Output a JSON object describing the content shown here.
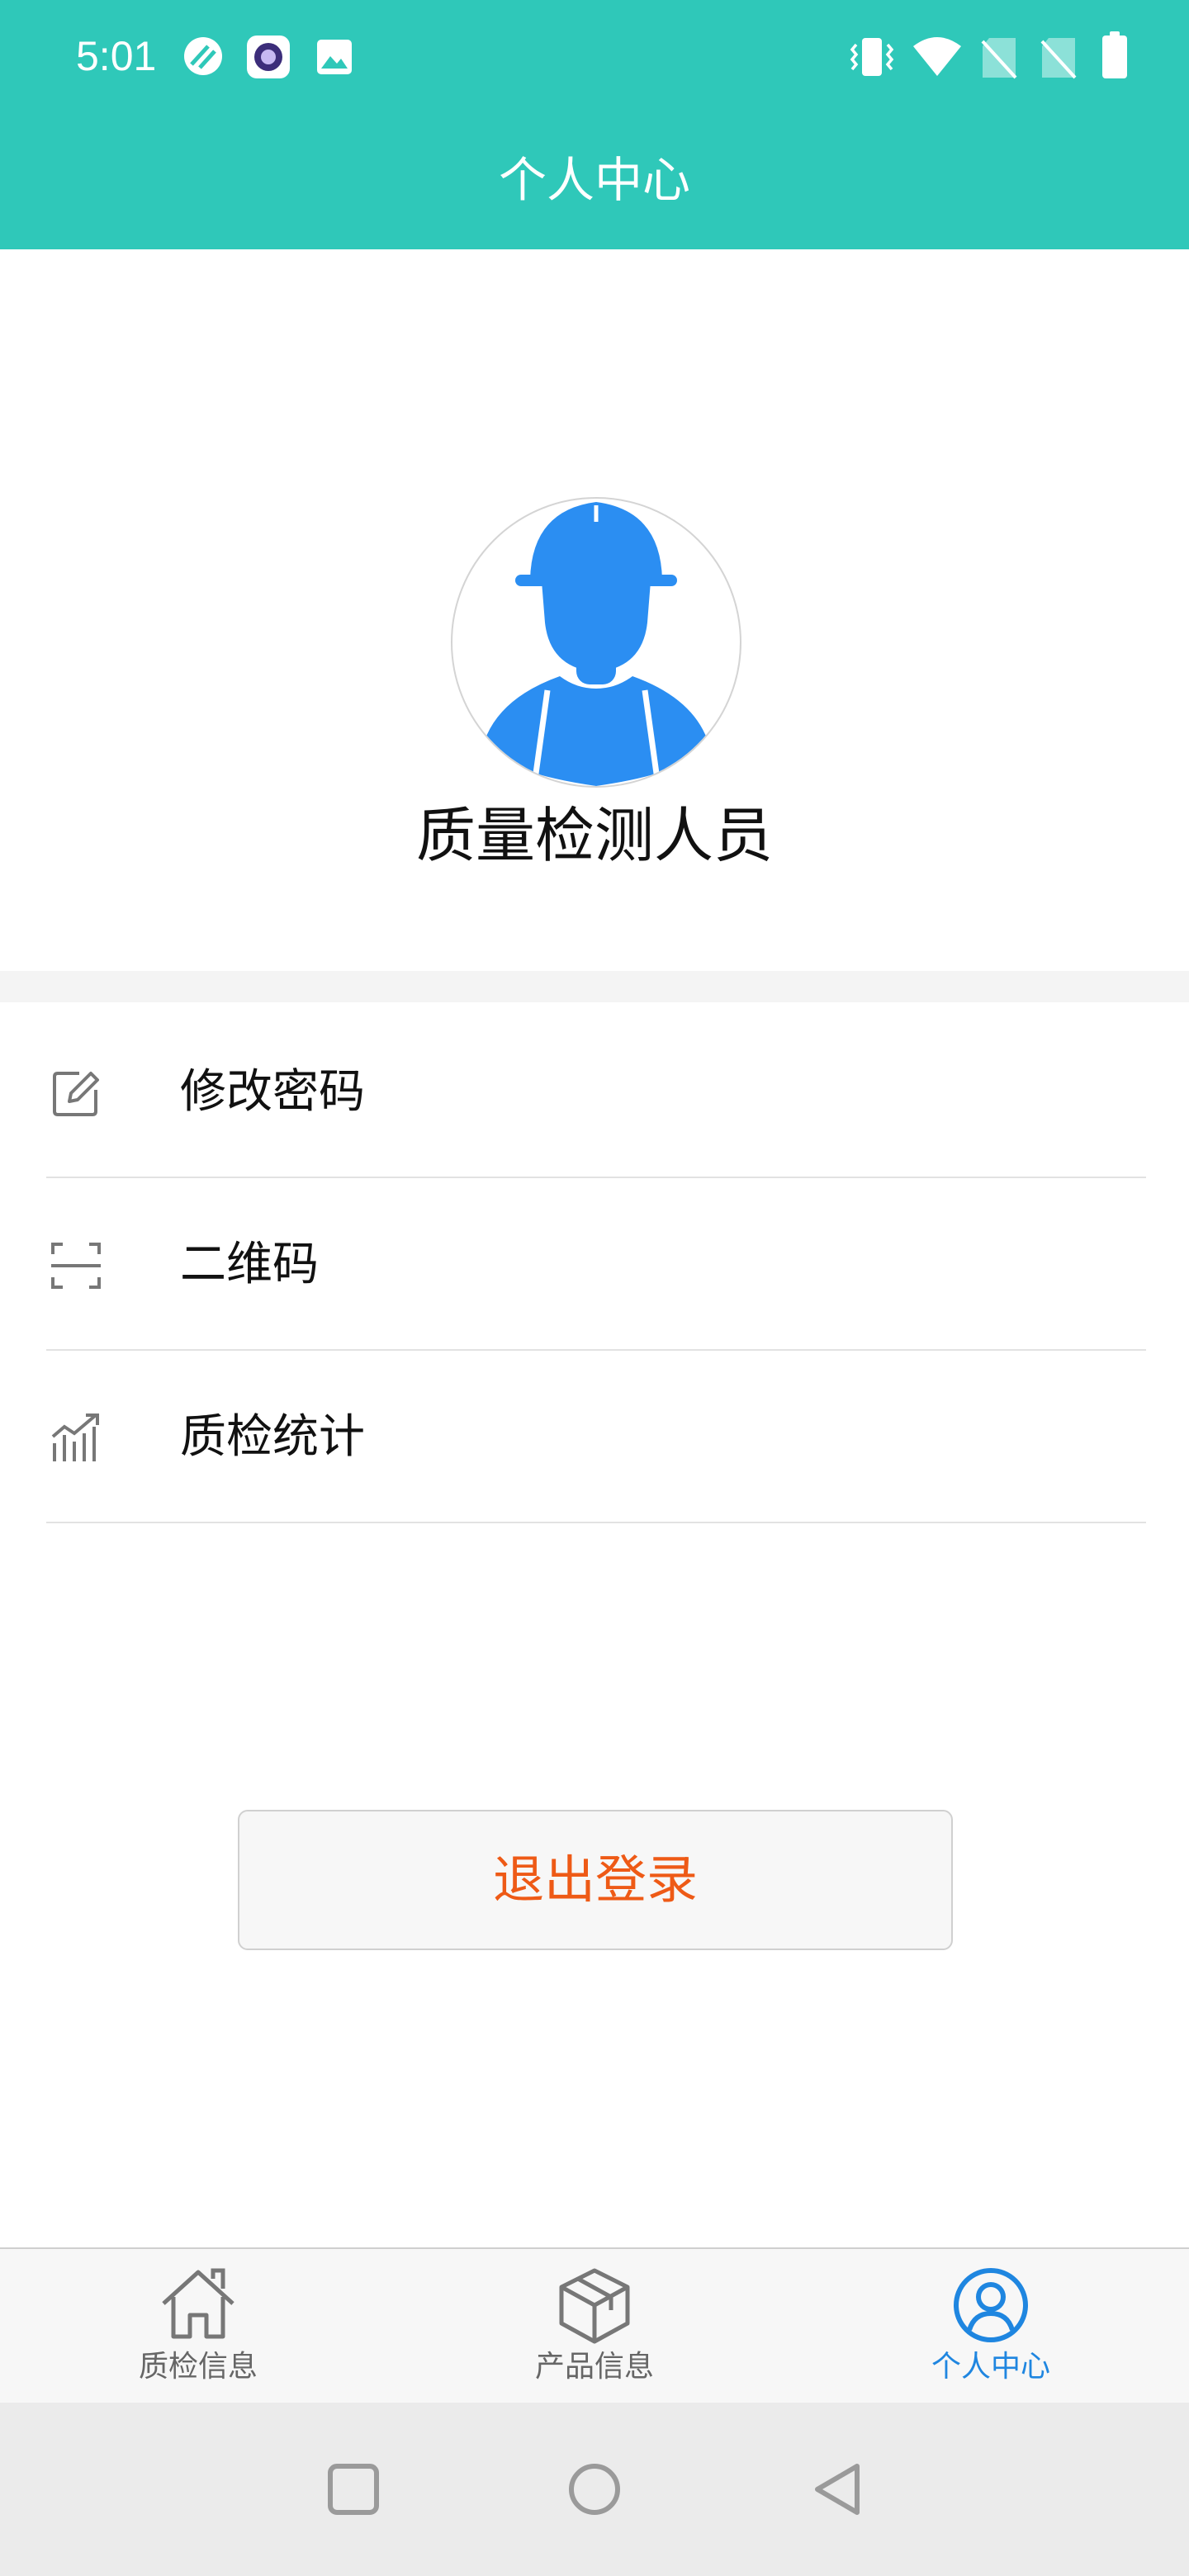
{
  "status_bar": {
    "time": "5:01",
    "left_icons": [
      "data-saver-icon",
      "app-notification-icon",
      "image-notification-icon"
    ],
    "right_icons": [
      "vibrate-icon",
      "wifi-icon",
      "no-sim-icon",
      "no-sim-icon",
      "battery-icon"
    ]
  },
  "header": {
    "title": "个人中心",
    "background_color": "#2fc8b9"
  },
  "profile": {
    "avatar_icon": "worker-avatar-icon",
    "avatar_color": "#2b8ef2",
    "name": "质量检测人员"
  },
  "menu": {
    "items": [
      {
        "label": "修改密码",
        "icon": "edit-icon"
      },
      {
        "label": "二维码",
        "icon": "scan-icon"
      },
      {
        "label": "质检统计",
        "icon": "stats-icon"
      }
    ]
  },
  "logout": {
    "label": "退出登录",
    "color": "#ee5a16"
  },
  "tabbar": {
    "tabs": [
      {
        "label": "质检信息",
        "icon": "home-icon",
        "active": false
      },
      {
        "label": "产品信息",
        "icon": "box-icon",
        "active": false
      },
      {
        "label": "个人中心",
        "icon": "user-circle-icon",
        "active": true
      }
    ],
    "active_color": "#1f86e0"
  },
  "system_nav": {
    "buttons": [
      "recents-square-icon",
      "home-circle-icon",
      "back-triangle-icon"
    ]
  }
}
